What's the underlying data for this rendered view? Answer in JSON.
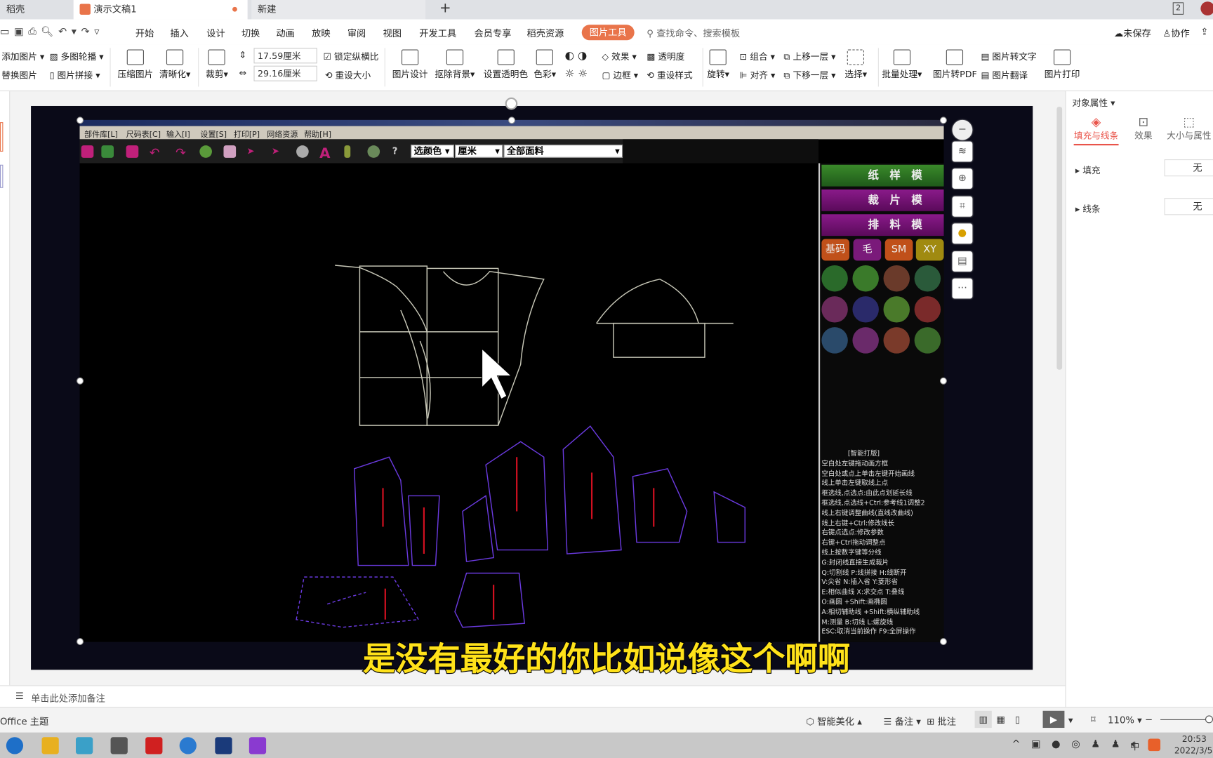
{
  "tabs": [
    {
      "label": "稻壳"
    },
    {
      "label": "演示文稿1",
      "modified_dot": "●"
    },
    {
      "label": "新建"
    }
  ],
  "new_tab": "+",
  "window_badge": "2",
  "menu": {
    "items": [
      "开始",
      "插入",
      "设计",
      "切换",
      "动画",
      "放映",
      "审阅",
      "视图",
      "开发工具",
      "会员专享",
      "稻壳资源"
    ],
    "active_tool": "图片工具",
    "search_placeholder": "查找命令、搜索模板",
    "unsaved": "未保存",
    "collab": "协作"
  },
  "ribbon": {
    "add_picture": "添加图片",
    "multi_carousel": "多图轮播",
    "replace_picture": "替换图片",
    "picture_collage": "图片拼接",
    "compress": "压缩图片",
    "sharpen": "清晰化",
    "crop": "裁剪",
    "height": "17.59厘米",
    "width": "29.16厘米",
    "lock_ratio": "锁定纵横比",
    "reset_size": "重设大小",
    "picture_design": "图片设计",
    "remove_bg": "抠除背景",
    "set_transparent": "设置透明色",
    "color": "色彩",
    "effects": "效果",
    "transparency": "透明度",
    "border": "边框",
    "reset_style": "重设样式",
    "rotate": "旋转",
    "group": "组合",
    "align": "对齐",
    "bring_forward": "上移一层",
    "send_backward": "下移一层",
    "select": "选择",
    "batch": "批量处理",
    "to_pdf": "图片转PDF",
    "to_text": "图片转文字",
    "translate": "图片翻译",
    "print": "图片打印"
  },
  "cad": {
    "menu": [
      "部件库[L]",
      "尺码表[C]",
      "输入[I]",
      "设置[S]",
      "打印[P]",
      "网络资源",
      "帮助[H]"
    ],
    "help_icon": "?",
    "color_select": "选颜色",
    "unit_select": "厘米",
    "fabric_select": "全部面料",
    "modes": [
      "纸样模式",
      "裁片模式",
      "排料模式"
    ],
    "quick": [
      "基码",
      "毛",
      "SM",
      "XY"
    ],
    "help_lines": [
      "[智能打版]",
      "空白处左键拖动画方框",
      "空白处或点上单击左键开始画线",
      "线上单击左键取线上点",
      "框选线,点选点:由此点划延长线",
      "框选线,点选线+Ctrl:参考线1调整2",
      "线上右键调整曲线(直线改曲线)",
      "线上右键+Ctrl:修改线长",
      "右键点选点:修改参数",
      "右键+Ctrl拖动调整点",
      "线上按数字键等分线",
      "G:封闭线直接生成裁片",
      "Q:切割线  P:线拼接  H:线断开",
      "V:尖省  N:插入省  Y:菱形省",
      "E:相似曲线  X:求交点  T:叠线",
      "O:画圆 +Shift:画椭圆",
      "A:相切辅助线 +Shift:横纵辅助线",
      "M:测量  B:切线  L:螺旋线",
      "ESC:取消当前操作  F9:全屏操作"
    ]
  },
  "subtitle": "是没有最好的你比如说像这个啊啊",
  "float_toolbar": [
    "minus-icon",
    "layers-icon",
    "zoom-in-icon",
    "crop-icon",
    "bulb-icon",
    "image-text-icon",
    "more-icon"
  ],
  "more_label": "···",
  "pane": {
    "title": "对象属性",
    "tabs": [
      "填充与线条",
      "效果",
      "大小与属性"
    ],
    "fill_label": "填充",
    "fill_value": "无",
    "line_label": "线条",
    "line_value": "无"
  },
  "notes_placeholder": "单击此处添加备注",
  "status": {
    "theme": "Office 主题",
    "beautify": "智能美化",
    "notes": "备注",
    "comments": "批注",
    "zoom": "110%"
  },
  "taskbar": {
    "time": "20:53",
    "date": "2022/3/5",
    "ime": "中"
  },
  "colors": {
    "accent": "#e9744a",
    "slide_bg": "#0a0a18",
    "subtitle": "#ffe21a"
  }
}
